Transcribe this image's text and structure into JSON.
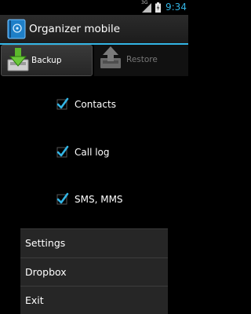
{
  "status_bar": {
    "time": "9:34",
    "network": "3G",
    "signal_icon": "signal-icon",
    "battery_icon": "battery-icon",
    "accent_color": "#33b5e5"
  },
  "action_bar": {
    "icon": "organizer-app-icon",
    "title": "Organizer mobile"
  },
  "tabs": [
    {
      "label": "Backup",
      "icon": "backup-download-icon",
      "selected": true
    },
    {
      "label": "Restore",
      "icon": "restore-upload-icon",
      "selected": false
    }
  ],
  "options": [
    {
      "label": "Contacts",
      "checked": true
    },
    {
      "label": "Call log",
      "checked": true
    },
    {
      "label": "SMS, MMS",
      "checked": true
    }
  ],
  "menu": {
    "items": [
      {
        "label": "Settings"
      },
      {
        "label": "Dropbox"
      },
      {
        "label": "Exit"
      }
    ]
  }
}
